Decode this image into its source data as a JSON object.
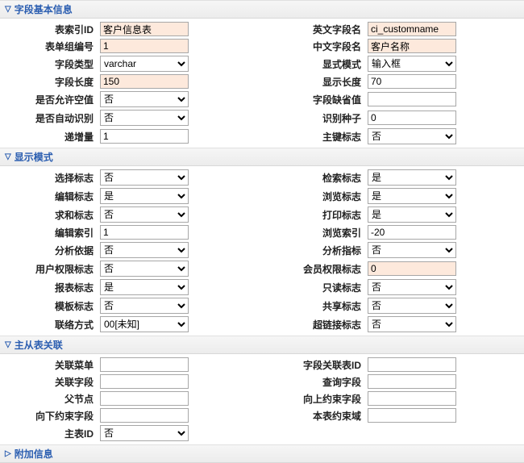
{
  "sections": {
    "basic": {
      "title": "字段基本信息"
    },
    "mode": {
      "title": "显示模式"
    },
    "rel": {
      "title": "主从表关联"
    },
    "extra": {
      "title": "附加信息"
    }
  },
  "basic": {
    "fieldIdLabel": "表索引ID",
    "fieldId": "客户信息表",
    "enNameLabel": "英文字段名",
    "enName": "ci_customname",
    "groupNoLabel": "表单组编号",
    "groupNo": "1",
    "cnNameLabel": "中文字段名",
    "cnName": "客户名称",
    "typeLabel": "字段类型",
    "type": "varchar",
    "dispModeLabel": "显式模式",
    "dispMode": "输入框",
    "lenLabel": "字段长度",
    "len": "150",
    "dispLenLabel": "显示长度",
    "dispLen": "70",
    "allowNullLabel": "是否允许空值",
    "allowNull": "否",
    "defaultLabel": "字段缺省值",
    "defaultVal": "",
    "autoIdLabel": "是否自动识别",
    "autoId": "否",
    "seedLabel": "识别种子",
    "seed": "0",
    "incLabel": "递增量",
    "inc": "1",
    "pkLabel": "主键标志",
    "pk": "否"
  },
  "mode": {
    "selectLabel": "选择标志",
    "select": "否",
    "retrieveLabel": "检索标志",
    "retrieve": "是",
    "editLabel": "编辑标志",
    "edit": "是",
    "browseLabel": "浏览标志",
    "browse": "是",
    "sumLabel": "求和标志",
    "sum": "否",
    "printLabel": "打印标志",
    "print": "是",
    "editIdxLabel": "编辑索引",
    "editIdx": "1",
    "browseIdxLabel": "浏览索引",
    "browseIdx": "-20",
    "analyseLabel": "分析依据",
    "analyse": "否",
    "analyseMetricLabel": "分析指标",
    "analyseMetric": "否",
    "userPermLabel": "用户权限标志",
    "userPerm": "否",
    "memberPermLabel": "会员权限标志",
    "memberPerm": "0",
    "reportLabel": "报表标志",
    "report": "是",
    "readOnlyLabel": "只读标志",
    "readOnly": "否",
    "tplLabel": "模板标志",
    "tpl": "否",
    "shareLabel": "共享标志",
    "share": "否",
    "linkTypeLabel": "联络方式",
    "linkType": "00[未知]",
    "hrefLabel": "超链接标志",
    "href": "否"
  },
  "rel": {
    "menuLabel": "关联菜单",
    "menu": "",
    "relTableIdLabel": "字段关联表ID",
    "relTableId": "",
    "relFieldLabel": "关联字段",
    "relField": "",
    "queryFieldLabel": "查询字段",
    "queryField": "",
    "parentLabel": "父节点",
    "parent": "",
    "upBoundLabel": "向上约束字段",
    "upBound": "",
    "downBoundLabel": "向下约束字段",
    "downBound": "",
    "boundDomainLabel": "本表约束域",
    "boundDomain": "",
    "mainTableIdLabel": "主表ID",
    "mainTableId": "否"
  }
}
